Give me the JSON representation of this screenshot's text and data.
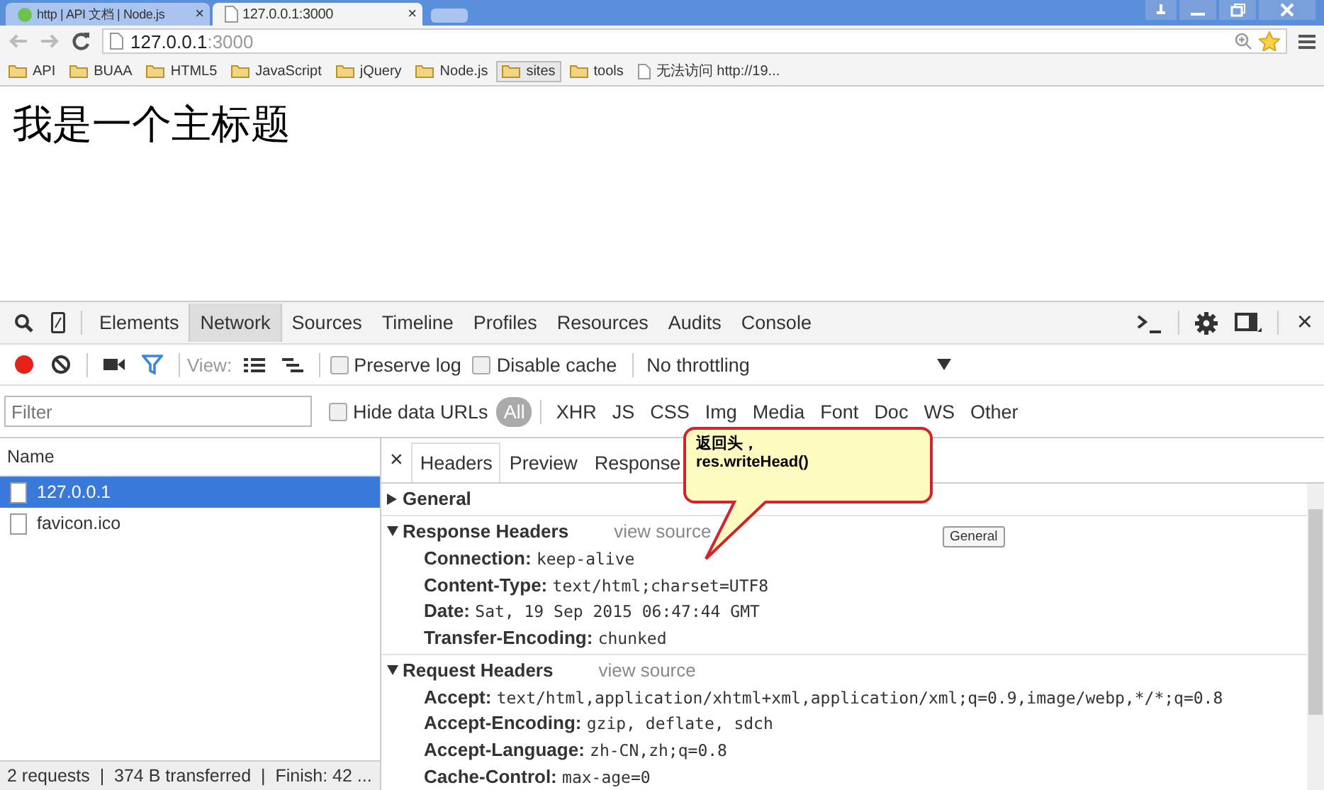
{
  "browser": {
    "tabs": [
      {
        "title": "http | API 文档 | Node.js",
        "kind": "dot",
        "selected": false
      },
      {
        "title": "127.0.0.1:3000",
        "kind": "page",
        "selected": true
      }
    ],
    "tab_close": "×",
    "address": {
      "host": "127.0.0.1",
      "port": ":3000"
    },
    "bookmarks": [
      {
        "label": "API",
        "kind": "folder",
        "selected": false
      },
      {
        "label": "BUAA",
        "kind": "folder",
        "selected": false
      },
      {
        "label": "HTML5",
        "kind": "folder",
        "selected": false
      },
      {
        "label": "JavaScript",
        "kind": "folder",
        "selected": false
      },
      {
        "label": "jQuery",
        "kind": "folder",
        "selected": false
      },
      {
        "label": "Node.js",
        "kind": "folder",
        "selected": false
      },
      {
        "label": "sites",
        "kind": "folder",
        "selected": true
      },
      {
        "label": "tools",
        "kind": "folder",
        "selected": false
      },
      {
        "label": "无法访问 http://19...",
        "kind": "page",
        "selected": false
      }
    ]
  },
  "page": {
    "heading": "我是一个主标题"
  },
  "devtools": {
    "panels": [
      {
        "label": "Elements",
        "selected": false
      },
      {
        "label": "Network",
        "selected": true
      },
      {
        "label": "Sources",
        "selected": false
      },
      {
        "label": "Timeline",
        "selected": false
      },
      {
        "label": "Profiles",
        "selected": false
      },
      {
        "label": "Resources",
        "selected": false
      },
      {
        "label": "Audits",
        "selected": false
      },
      {
        "label": "Console",
        "selected": false
      }
    ],
    "close": "×",
    "recording": true,
    "filter_on": true,
    "view_label": "View:",
    "options": [
      {
        "label": "Preserve log",
        "checked": false
      },
      {
        "label": "Disable cache",
        "checked": false
      }
    ],
    "throttling": "No throttling",
    "filter": {
      "placeholder": "Filter"
    },
    "hide_data_urls": {
      "label": "Hide data URLs",
      "checked": false
    },
    "types": [
      {
        "label": "All",
        "selected": true
      },
      {
        "label": "XHR",
        "selected": false
      },
      {
        "label": "JS",
        "selected": false
      },
      {
        "label": "CSS",
        "selected": false
      },
      {
        "label": "Img",
        "selected": false
      },
      {
        "label": "Media",
        "selected": false
      },
      {
        "label": "Font",
        "selected": false
      },
      {
        "label": "Doc",
        "selected": false
      },
      {
        "label": "WS",
        "selected": false
      },
      {
        "label": "Other",
        "selected": false
      }
    ],
    "requests": {
      "column": "Name",
      "rows": [
        {
          "name": "127.0.0.1",
          "selected": true
        },
        {
          "name": "favicon.ico",
          "selected": false
        }
      ],
      "status": "2 requests  |  374 B transferred  |  Finish: 42 ..."
    },
    "detail": {
      "close": "×",
      "tabs": [
        {
          "label": "Headers",
          "selected": true
        },
        {
          "label": "Preview",
          "selected": false
        },
        {
          "label": "Response",
          "selected": false
        }
      ],
      "sections": [
        {
          "title": "General",
          "expanded": false
        },
        {
          "title": "Response Headers",
          "expanded": true,
          "view_source": "view source",
          "headers": [
            {
              "name": "Connection:",
              "value": "keep-alive"
            },
            {
              "name": "Content-Type:",
              "value": "text/html;charset=UTF8"
            },
            {
              "name": "Date:",
              "value": "Sat, 19 Sep 2015 06:47:44 GMT"
            },
            {
              "name": "Transfer-Encoding:",
              "value": "chunked"
            }
          ]
        },
        {
          "title": "Request Headers",
          "expanded": true,
          "view_source": "view source",
          "headers": [
            {
              "name": "Accept:",
              "value": "text/html,application/xhtml+xml,application/xml;q=0.9,image/webp,*/*;q=0.8"
            },
            {
              "name": "Accept-Encoding:",
              "value": "gzip, deflate, sdch"
            },
            {
              "name": "Accept-Language:",
              "value": "zh-CN,zh;q=0.8"
            },
            {
              "name": "Cache-Control:",
              "value": "max-age=0"
            }
          ]
        }
      ],
      "tooltip": "General"
    }
  },
  "callout": {
    "lines": [
      "返回头，",
      "res.writeHead()"
    ]
  }
}
